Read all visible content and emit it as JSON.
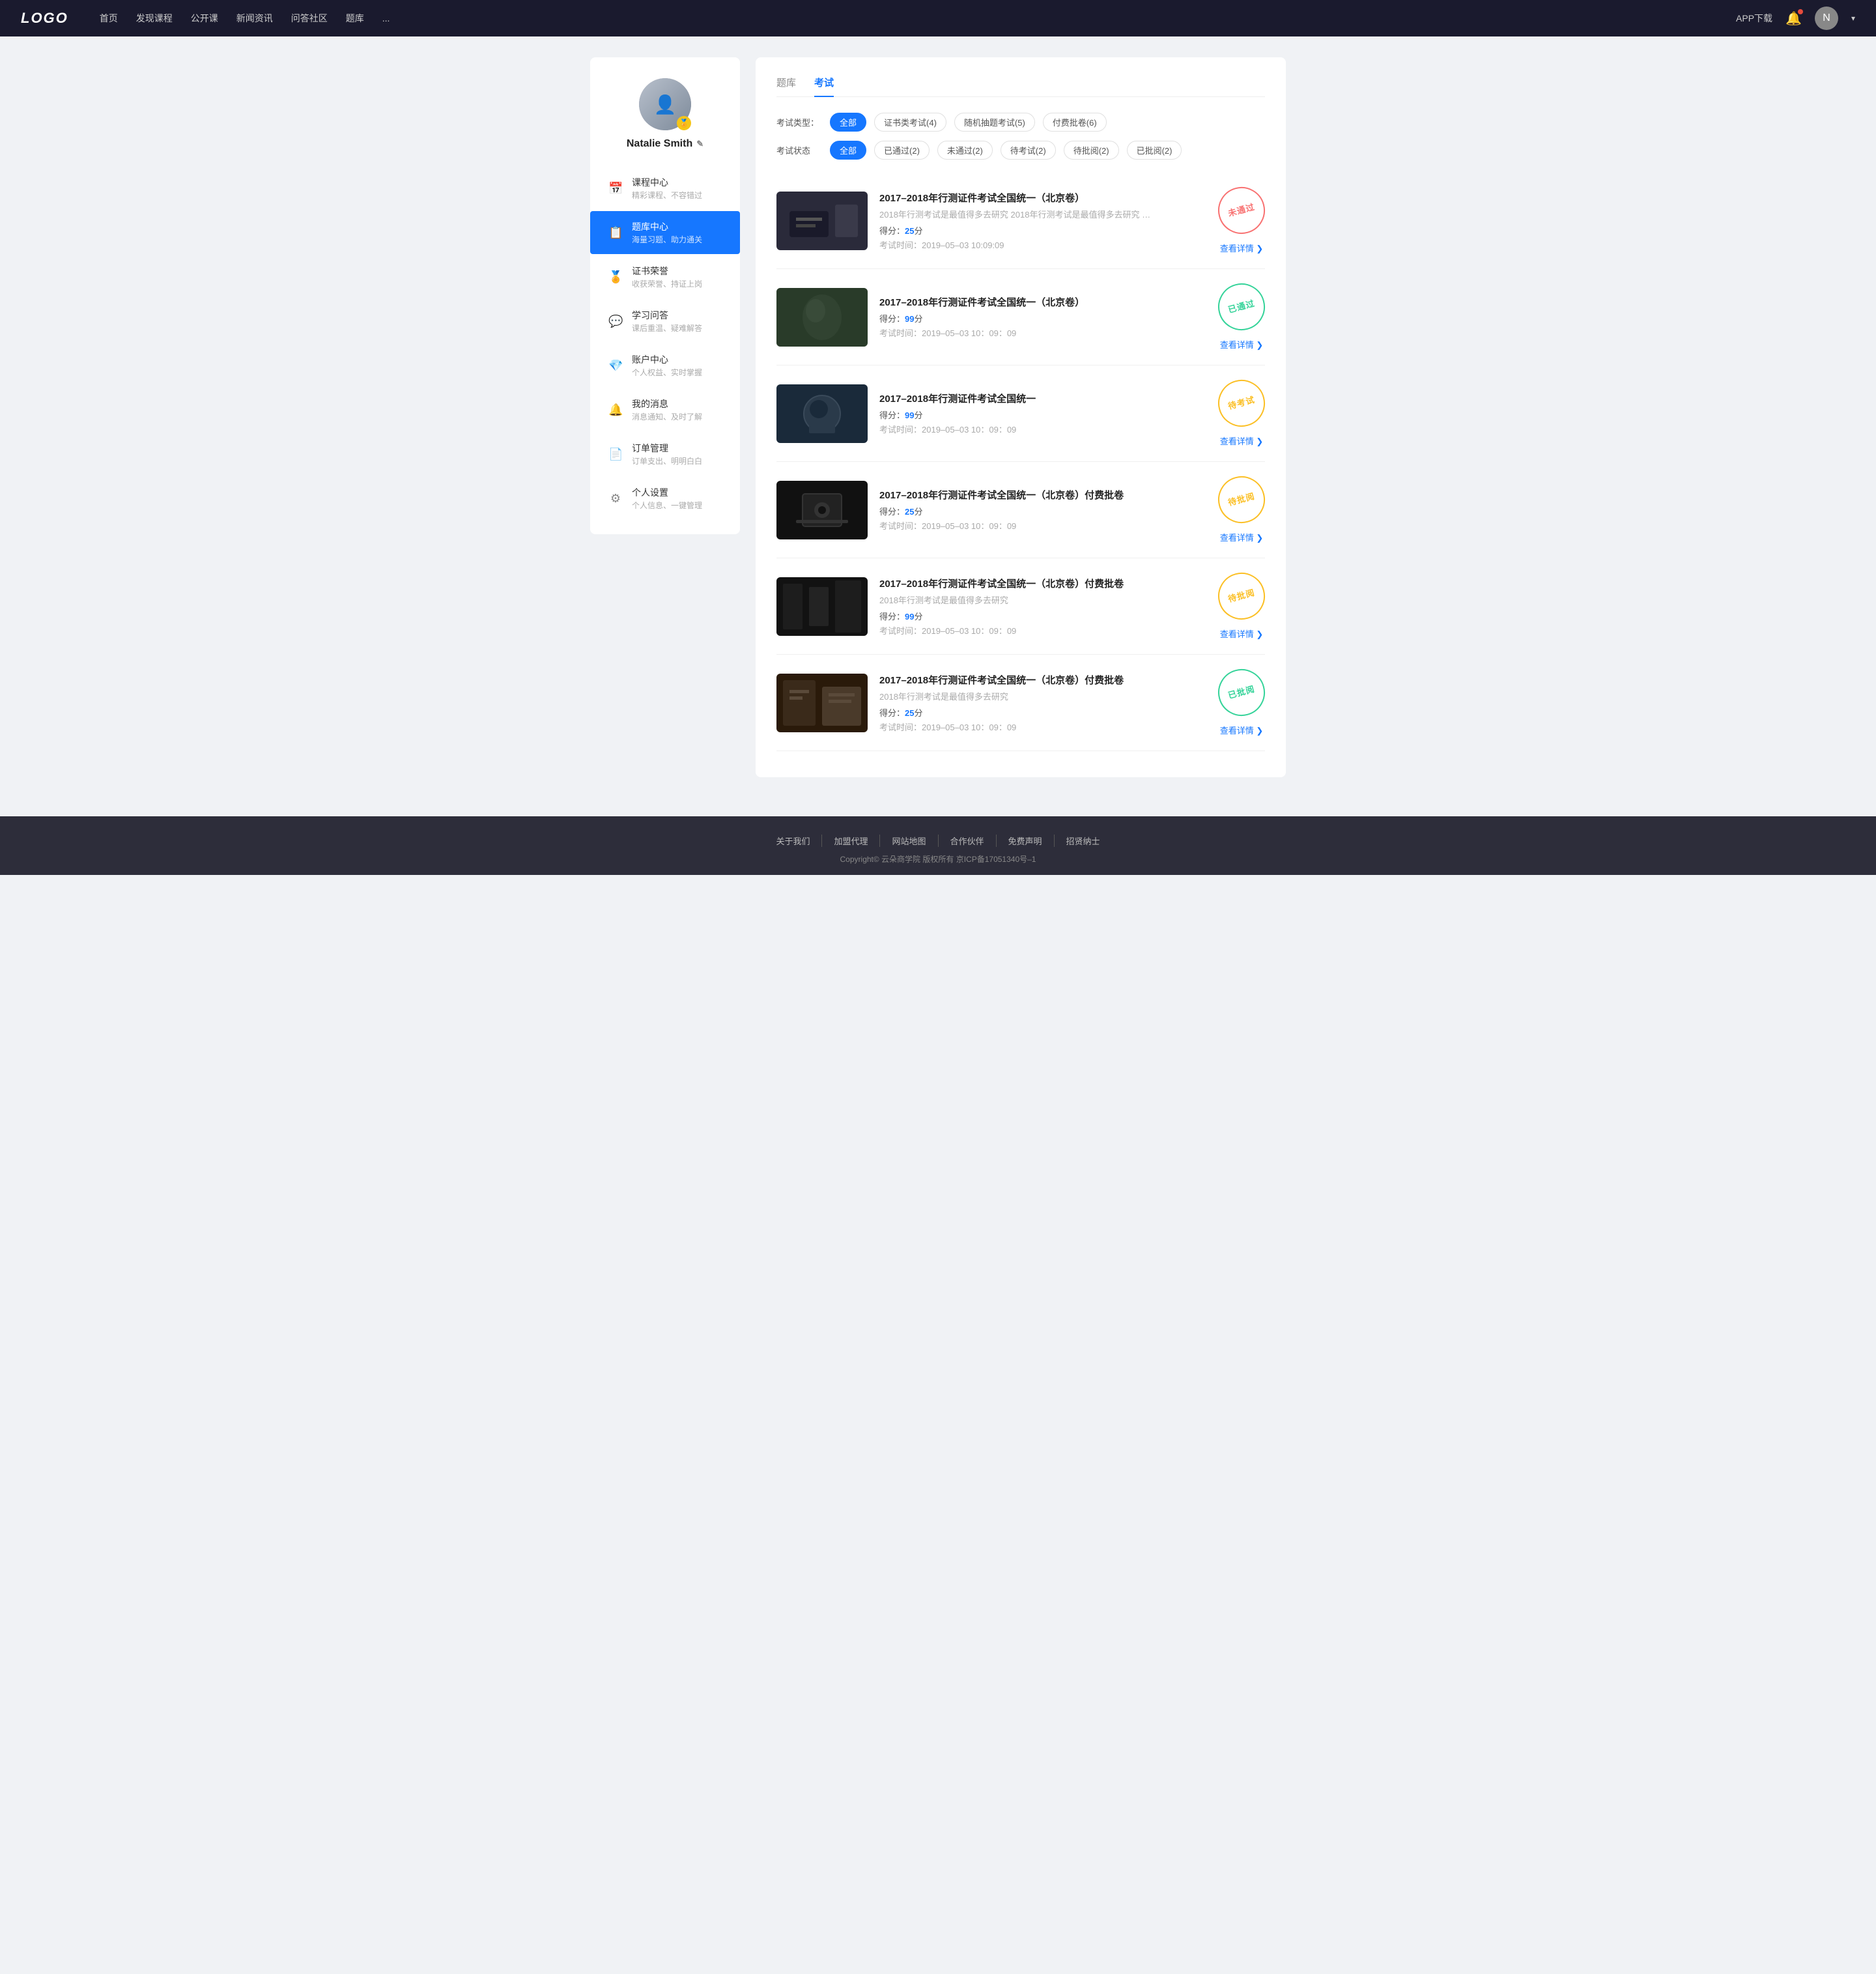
{
  "navbar": {
    "logo": "LOGO",
    "nav_items": [
      "首页",
      "发现课程",
      "公开课",
      "新闻资讯",
      "问答社区",
      "题库",
      "..."
    ],
    "app_btn": "APP下载",
    "user_name": "Natalie Smith"
  },
  "sidebar": {
    "username": "Natalie Smith",
    "edit_label": "✎",
    "menu": [
      {
        "id": "course-center",
        "icon": "📅",
        "label": "课程中心",
        "sublabel": "精彩课程、不容错过",
        "active": false
      },
      {
        "id": "question-bank",
        "icon": "📋",
        "label": "题库中心",
        "sublabel": "海量习题、助力通关",
        "active": true
      },
      {
        "id": "certificate",
        "icon": "🏅",
        "label": "证书荣誉",
        "sublabel": "收获荣誉、持证上岗",
        "active": false
      },
      {
        "id": "qa",
        "icon": "💬",
        "label": "学习问答",
        "sublabel": "课后重温、疑难解答",
        "active": false
      },
      {
        "id": "account",
        "icon": "💎",
        "label": "账户中心",
        "sublabel": "个人权益、实时掌握",
        "active": false
      },
      {
        "id": "message",
        "icon": "🔔",
        "label": "我的消息",
        "sublabel": "消息通知、及时了解",
        "active": false
      },
      {
        "id": "orders",
        "icon": "📄",
        "label": "订单管理",
        "sublabel": "订单支出、明明白白",
        "active": false
      },
      {
        "id": "settings",
        "icon": "⚙",
        "label": "个人设置",
        "sublabel": "个人信息、一键管理",
        "active": false
      }
    ]
  },
  "main": {
    "tabs": [
      {
        "id": "question-bank-tab",
        "label": "题库",
        "active": false
      },
      {
        "id": "exam-tab",
        "label": "考试",
        "active": true
      }
    ],
    "exam_type_label": "考试类型：",
    "exam_type_filters": [
      {
        "label": "全部",
        "active": true
      },
      {
        "label": "证书类考试(4)",
        "active": false
      },
      {
        "label": "随机抽题考试(5)",
        "active": false
      },
      {
        "label": "付费批卷(6)",
        "active": false
      }
    ],
    "exam_status_label": "考试状态",
    "exam_status_filters": [
      {
        "label": "全部",
        "active": true
      },
      {
        "label": "已通过(2)",
        "active": false
      },
      {
        "label": "未通过(2)",
        "active": false
      },
      {
        "label": "待考试(2)",
        "active": false
      },
      {
        "label": "待批阅(2)",
        "active": false
      },
      {
        "label": "已批阅(2)",
        "active": false
      }
    ],
    "exams": [
      {
        "id": "exam-1",
        "title": "2017–2018年行测证件考试全国统一（北京卷）",
        "desc": "2018年行测考试是最值得多去研究 2018年行测考试是最值得多去研究 2018年行...",
        "score_label": "得分：",
        "score": "25",
        "score_unit": "分",
        "time_label": "考试时间：",
        "time": "2019–05–03  10:09:09",
        "stamp_text": "未通过",
        "stamp_type": "fail",
        "detail_label": "查看详情",
        "thumb_type": "1"
      },
      {
        "id": "exam-2",
        "title": "2017–2018年行测证件考试全国统一（北京卷）",
        "desc": "",
        "score_label": "得分：",
        "score": "99",
        "score_unit": "分",
        "time_label": "考试时间：",
        "time": "2019–05–03  10：09：09",
        "stamp_text": "已通过",
        "stamp_type": "pass",
        "detail_label": "查看详情",
        "thumb_type": "2"
      },
      {
        "id": "exam-3",
        "title": "2017–2018年行测证件考试全国统一",
        "desc": "",
        "score_label": "得分：",
        "score": "99",
        "score_unit": "分",
        "time_label": "考试时间：",
        "time": "2019–05–03  10：09：09",
        "stamp_text": "待考试",
        "stamp_type": "pending",
        "detail_label": "查看详情",
        "thumb_type": "3"
      },
      {
        "id": "exam-4",
        "title": "2017–2018年行测证件考试全国统一（北京卷）付费批卷",
        "desc": "",
        "score_label": "得分：",
        "score": "25",
        "score_unit": "分",
        "time_label": "考试时间：",
        "time": "2019–05–03  10：09：09",
        "stamp_text": "待批阅",
        "stamp_type": "review",
        "detail_label": "查看详情",
        "thumb_type": "4"
      },
      {
        "id": "exam-5",
        "title": "2017–2018年行测证件考试全国统一（北京卷）付费批卷",
        "desc": "2018年行测考试是最值得多去研究",
        "score_label": "得分：",
        "score": "99",
        "score_unit": "分",
        "time_label": "考试时间：",
        "time": "2019–05–03  10：09：09",
        "stamp_text": "待批阅",
        "stamp_type": "review",
        "detail_label": "查看详情",
        "thumb_type": "5"
      },
      {
        "id": "exam-6",
        "title": "2017–2018年行测证件考试全国统一（北京卷）付费批卷",
        "desc": "2018年行测考试是最值得多去研究",
        "score_label": "得分：",
        "score": "25",
        "score_unit": "分",
        "time_label": "考试时间：",
        "time": "2019–05–03  10：09：09",
        "stamp_text": "已批阅",
        "stamp_type": "reviewed",
        "detail_label": "查看详情",
        "thumb_type": "6"
      }
    ]
  },
  "footer": {
    "links": [
      "关于我们",
      "加盟代理",
      "网站地图",
      "合作伙伴",
      "免费声明",
      "招贤纳士"
    ],
    "copyright": "Copyright© 云朵商学院  版权所有    京ICP备17051340号–1"
  }
}
